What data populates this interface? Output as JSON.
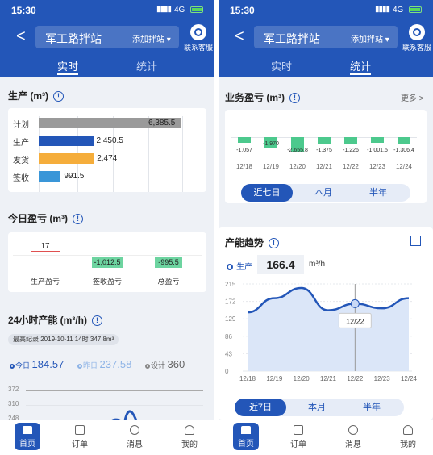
{
  "status": {
    "time": "15:30",
    "network": "4G"
  },
  "header": {
    "back": "<",
    "station": "军工路拌站",
    "add_station": "添加拌站 ▾",
    "service": "联系客服"
  },
  "left": {
    "tabs": {
      "realtime": "实时",
      "stats": "统计"
    },
    "production": {
      "title": "生产 (m³)",
      "bars": [
        {
          "label": "计划",
          "value": "6,385.5",
          "num": 6385.5,
          "color": "#9a9a9a"
        },
        {
          "label": "生产",
          "value": "2,450.5",
          "num": 2450.5,
          "color": "#2356b8"
        },
        {
          "label": "发货",
          "value": "2,474",
          "num": 2474,
          "color": "#f5ad3b"
        },
        {
          "label": "签收",
          "value": "991.5",
          "num": 991.5,
          "color": "#3a96d8"
        }
      ]
    },
    "today": {
      "title": "今日盈亏 (m³)",
      "items": [
        {
          "value": "17",
          "label": "生产盈亏"
        },
        {
          "value": "-1,012.5",
          "label": "签收盈亏"
        },
        {
          "value": "-995.5",
          "label": "总盈亏"
        }
      ]
    },
    "capacity": {
      "title": "24小时产能 (m³/h)",
      "record": "最高纪录 2019-10-11 14时 347.8m³",
      "today_label": "今日",
      "today_value": "184.57",
      "yesterday_label": "昨日",
      "yesterday_value": "237.58",
      "design_label": "设计",
      "design_value": "360",
      "yticks": [
        "372",
        "310",
        "248"
      ]
    }
  },
  "right": {
    "tabs": {
      "realtime": "实时",
      "stats": "统计"
    },
    "profit": {
      "title": "业务盈亏 (m³)",
      "more": "更多 >",
      "bars": [
        {
          "value": "-1,057",
          "num": -1057,
          "date": "12/18"
        },
        {
          "value": "-1,970",
          "num": -1970,
          "date": "12/19"
        },
        {
          "value": "-2,655.8",
          "num": -2655.8,
          "date": "12/20"
        },
        {
          "value": "-1,375",
          "num": -1375,
          "date": "12/21"
        },
        {
          "value": "-1,226",
          "num": -1226,
          "date": "12/22"
        },
        {
          "value": "-1,001.5",
          "num": -1001.5,
          "date": "12/23"
        },
        {
          "value": "-1,306.4",
          "num": -1306.4,
          "date": "12/24"
        }
      ],
      "periods": [
        "近七日",
        "本月",
        "半年"
      ]
    },
    "trend": {
      "title": "产能趋势",
      "legend": "生产",
      "current": "166.4",
      "unit": "m³/h",
      "tooltip": "12/22",
      "periods": [
        "近7日",
        "本月",
        "半年"
      ]
    }
  },
  "nav": [
    "首页",
    "订单",
    "消息",
    "我的"
  ],
  "chart_data": [
    {
      "type": "bar",
      "title": "生产 (m³)",
      "categories": [
        "计划",
        "生产",
        "发货",
        "签收"
      ],
      "values": [
        6385.5,
        2450.5,
        2474,
        991.5
      ]
    },
    {
      "type": "bar",
      "title": "业务盈亏 (m³)",
      "categories": [
        "12/18",
        "12/19",
        "12/20",
        "12/21",
        "12/22",
        "12/23",
        "12/24"
      ],
      "values": [
        -1057,
        -1970,
        -2655.8,
        -1375,
        -1226,
        -1001.5,
        -1306.4
      ]
    },
    {
      "type": "area",
      "title": "产能趋势",
      "x": [
        "12/18",
        "12/19",
        "12/20",
        "12/21",
        "12/22",
        "12/23",
        "12/24"
      ],
      "series": [
        {
          "name": "生产",
          "values": [
            145,
            180,
            205,
            150,
            166.4,
            155,
            180
          ]
        }
      ],
      "yticks": [
        0,
        43,
        86,
        129,
        172,
        215
      ],
      "ylim": [
        0,
        215
      ]
    }
  ]
}
